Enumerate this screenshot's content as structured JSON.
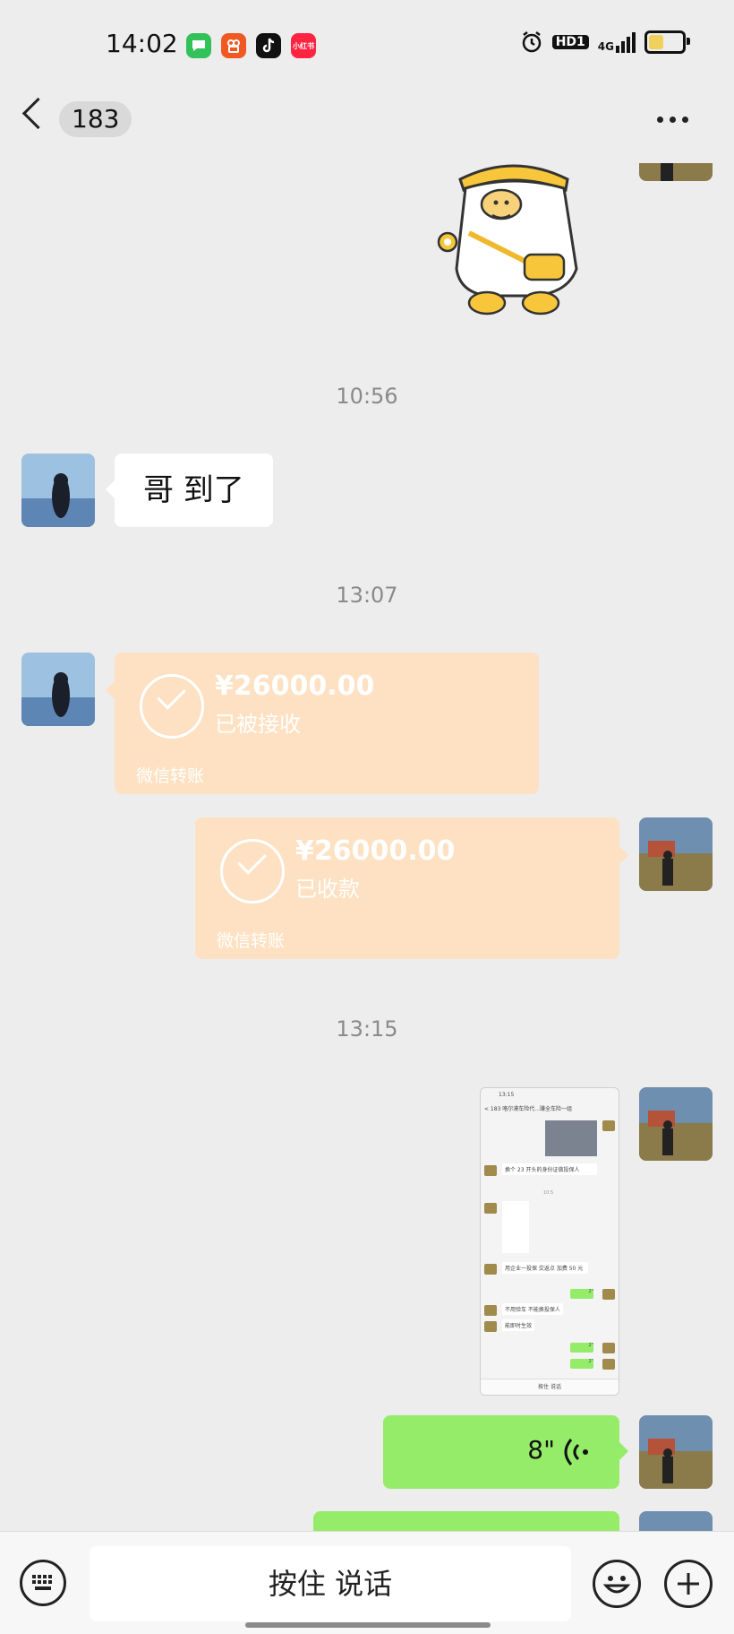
{
  "status_bar": {
    "time": "14:02",
    "app_icons": [
      {
        "name": "messages-app-icon",
        "color": "#33c15a",
        "glyph": "💬"
      },
      {
        "name": "kuaishou-app-icon",
        "color": "#f05a22",
        "glyph": "◉"
      },
      {
        "name": "douyin-app-icon",
        "color": "#111111",
        "glyph": "♪"
      },
      {
        "name": "xiaohongshu-app-icon",
        "color": "#ff2442",
        "glyph": "小红书"
      }
    ],
    "hd_label": "HD1",
    "network": "4G",
    "battery_level": 0.45
  },
  "header": {
    "unread_count": "183"
  },
  "timestamps": [
    "10:56",
    "13:07",
    "13:15"
  ],
  "messages": {
    "text_message": "哥 到了",
    "transfer_received": {
      "amount": "¥26000.00",
      "status": "已被接收",
      "footer": "微信转账"
    },
    "transfer_sent": {
      "amount": "¥26000.00",
      "status": "已收款",
      "footer": "微信转账"
    },
    "voice": {
      "duration": "8\""
    }
  },
  "screenshot_thumbnail": {
    "time": "13:15",
    "title": "< 183  咯尔漠车险代...赚全车险一组",
    "msg1": "换个 23 开头的身份证做投保人",
    "timestamp": "10:5",
    "msg2": "用企业一投保 交返点 加费 50 元",
    "msg3": "不用验车 不能换投保人",
    "msg4": "能即时生效",
    "voice1": "2\"",
    "voice2": "2\"",
    "voice3": "2\"",
    "input": "按住 说话"
  },
  "input_bar": {
    "hold_to_talk": "按住 说话"
  },
  "colors": {
    "background": "#ededed",
    "transfer_card": "#fde1c2",
    "sent_bubble": "#95ec69"
  }
}
